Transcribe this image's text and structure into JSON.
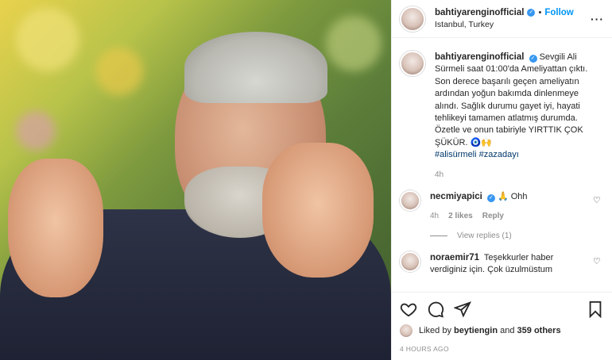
{
  "header": {
    "username": "bahtiyarenginofficial",
    "separator": "•",
    "follow_label": "Follow",
    "location": "Istanbul, Turkey",
    "more": "···"
  },
  "caption": {
    "username": "bahtiyarenginofficial",
    "text": "Sevgili Ali Sürmeli saat 01:00'da Ameliyattan çıktı. Son derece başarılı geçen ameliyatın ardından yoğun bakımda dinlenmeye alındı. Sağlık durumu gayet iyi, hayati tehlikeyi tamamen atlatmış durumda. Özetle ve onun tabiriyle YIRTTIK ÇOK ŞÜKÜR. 🧿🙌",
    "hashtags": "#alisürmeli #zazadayı",
    "time": "4h"
  },
  "comments": [
    {
      "username": "necmiyapici",
      "text": "🙏 Ohh",
      "time": "4h",
      "likes": "2 likes",
      "reply": "Reply",
      "view_replies": "View replies (1)"
    },
    {
      "username": "noraemir71",
      "text": "Teşekkurler haber verdiginiz için. Çok üzulmüstum"
    }
  ],
  "actions": {
    "liked_by_prefix": "Liked by",
    "liked_by_user": "beytiengin",
    "liked_by_mid": "and",
    "liked_by_others": "359 others",
    "timestamp": "4 HOURS AGO"
  }
}
